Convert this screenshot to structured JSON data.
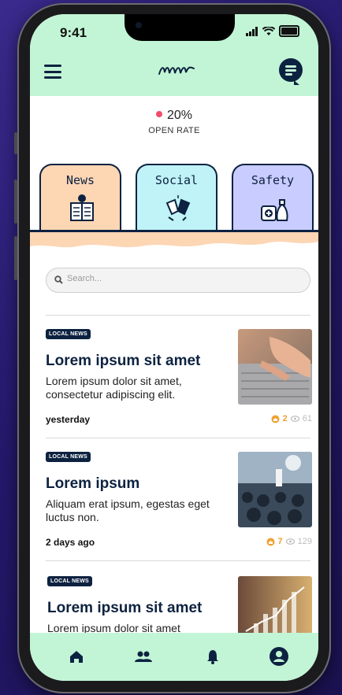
{
  "status_bar": {
    "time": "9:41"
  },
  "header": {
    "menu_icon": "hamburger-menu-icon",
    "logo_icon": "squiggle-logo-icon",
    "chat_icon": "chat-bubble-icon"
  },
  "open_rate": {
    "value": "20%",
    "label": "OPEN RATE",
    "dot_color": "#ef4d6a"
  },
  "tabs": [
    {
      "label": "News",
      "icon": "newspaper-icon",
      "color": "#fdd6b4"
    },
    {
      "label": "Social",
      "icon": "cheers-cups-icon",
      "color": "#bff3f7"
    },
    {
      "label": "Safety",
      "icon": "first-aid-bag-icon",
      "color": "#c8ccff"
    }
  ],
  "search": {
    "placeholder": "Search..."
  },
  "articles": [
    {
      "badge": "LOCAL NEWS",
      "title": "Lorem ipsum sit amet",
      "body": "Lorem ipsum dolor sit amet, consectetur adipiscing elit.",
      "date": "yesterday",
      "likes": "2",
      "views": "61",
      "image": "laptop-typing-photo"
    },
    {
      "badge": "LOCAL NEWS",
      "title": "Lorem ipsum",
      "body": "Aliquam erat ipsum, egestas eget luctus non.",
      "date": "2 days ago",
      "likes": "7",
      "views": "129",
      "image": "conference-audience-photo"
    },
    {
      "badge": "LOCAL NEWS",
      "title": "Lorem ipsum sit amet",
      "body": "Lorem ipsum dolor sit amet",
      "image": "finance-chart-photo"
    }
  ],
  "bottom_nav": [
    {
      "icon": "home-icon"
    },
    {
      "icon": "people-icon"
    },
    {
      "icon": "bell-icon"
    },
    {
      "icon": "profile-icon"
    }
  ],
  "colors": {
    "accent": "#c2f5d6",
    "navy": "#0d2240",
    "peach": "#fdd6b4"
  }
}
